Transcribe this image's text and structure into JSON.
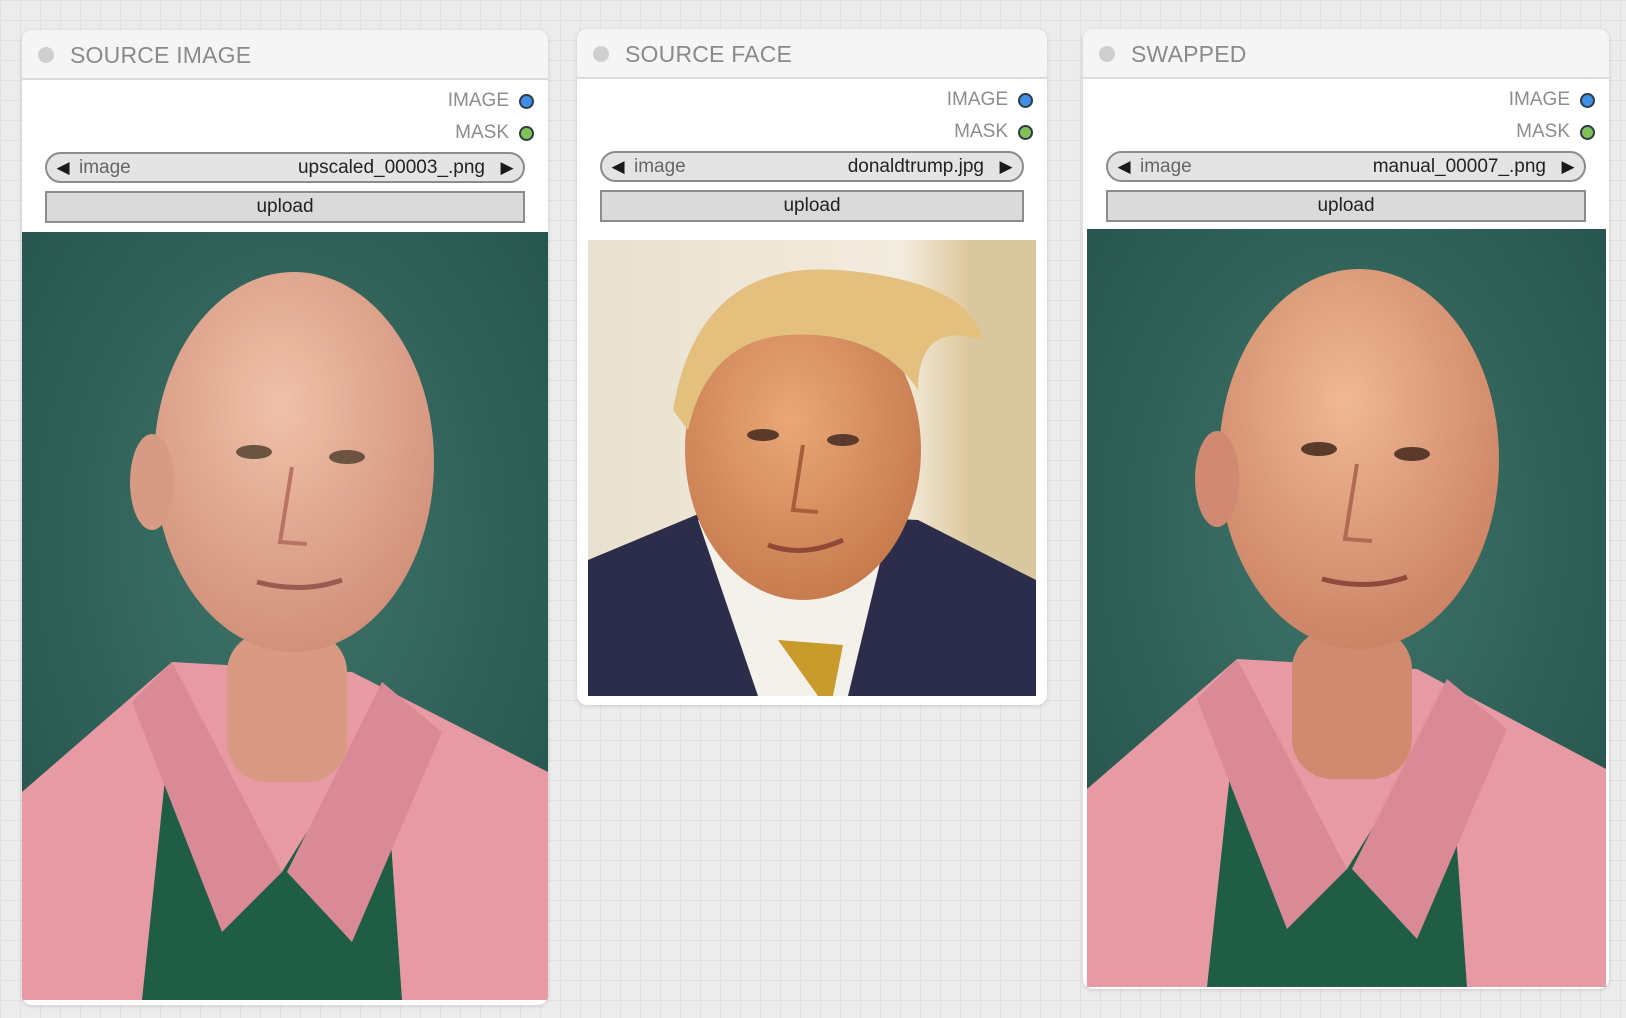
{
  "nodes": [
    {
      "title": "SOURCE IMAGE",
      "outputs": [
        {
          "label": "IMAGE",
          "color": "#3f8fe8"
        },
        {
          "label": "MASK",
          "color": "#80c25a"
        }
      ],
      "combo": {
        "name": "image",
        "value": "upscaled_00003_.png"
      },
      "upload_label": "upload"
    },
    {
      "title": "SOURCE FACE",
      "outputs": [
        {
          "label": "IMAGE",
          "color": "#3f8fe8"
        },
        {
          "label": "MASK",
          "color": "#80c25a"
        }
      ],
      "combo": {
        "name": "image",
        "value": "donaldtrump.jpg"
      },
      "upload_label": "upload"
    },
    {
      "title": "SWAPPED",
      "outputs": [
        {
          "label": "IMAGE",
          "color": "#3f8fe8"
        },
        {
          "label": "MASK",
          "color": "#80c25a"
        }
      ],
      "combo": {
        "name": "image",
        "value": "manual_00007_.png"
      },
      "upload_label": "upload"
    }
  ],
  "icons": {
    "prev": "left-triangle-icon",
    "next": "right-triangle-icon",
    "collapse": "collapse-dot-icon"
  }
}
